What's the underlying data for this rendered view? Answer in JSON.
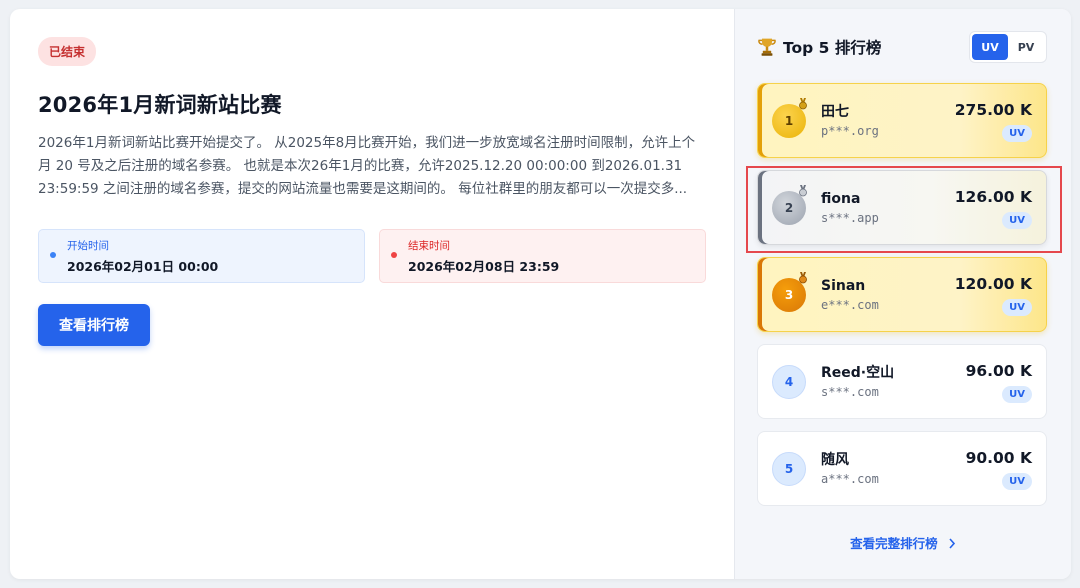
{
  "contest": {
    "status": "已结束",
    "title": "2026年1月新词新站比赛",
    "description": "2026年1月新词新站比赛开始提交了。 从2025年8月比赛开始，我们进一步放宽域名注册时间限制，允许上个月 20 号及之后注册的域名参赛。 也就是本次26年1月的比赛，允许2025.12.20 00:00:00 到2026.01.31 23:59:59 之间注册的域名参赛，提交的网站流量也需要是这期间的。 每位社群里的朋友都可以一次提交多...",
    "start": {
      "label": "开始时间",
      "value": "2026年02月01日 00:00"
    },
    "end": {
      "label": "结束时间",
      "value": "2026年02月08日 23:59"
    },
    "leaderboard_button": "查看排行榜"
  },
  "ranking": {
    "title": "Top 5 排行榜",
    "toggle": {
      "uv": "UV",
      "pv": "PV",
      "active": "UV"
    },
    "items": [
      {
        "rank": "1",
        "name": "田七",
        "domain": "p***.org",
        "value": "275.00 K",
        "metric": "UV"
      },
      {
        "rank": "2",
        "name": "fiona",
        "domain": "s***.app",
        "value": "126.00 K",
        "metric": "UV"
      },
      {
        "rank": "3",
        "name": "Sinan",
        "domain": "e***.com",
        "value": "120.00 K",
        "metric": "UV"
      },
      {
        "rank": "4",
        "name": "Reed·空山",
        "domain": "s***.com",
        "value": "96.00 K",
        "metric": "UV"
      },
      {
        "rank": "5",
        "name": "随风",
        "domain": "a***.com",
        "value": "90.00 K",
        "metric": "UV"
      }
    ],
    "view_all": "查看完整排行榜"
  },
  "colors": {
    "primary": "#2563eb",
    "gold": "#eab308",
    "silver": "#9ca3af",
    "bronze": "#d97706",
    "ended": "#c53030",
    "highlight": "#e5484d"
  },
  "icons": [
    "trophy-icon",
    "medal-icon",
    "chevron-right-icon"
  ]
}
